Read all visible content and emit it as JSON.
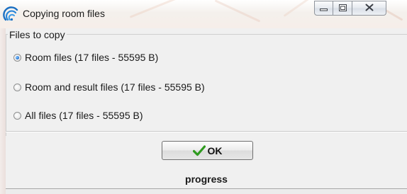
{
  "window": {
    "title": "Copying room files",
    "icon": "app-logo-icon",
    "controls": {
      "minimize_icon": "minimize-icon",
      "maximize_icon": "maximize-icon",
      "close_icon": "close-icon"
    }
  },
  "files_group": {
    "legend": "Files to copy",
    "options": [
      {
        "label": "Room files  (17 files - 55595  B)",
        "checked": true
      },
      {
        "label": "Room and result files  (17 files - 55595  B)",
        "checked": false
      },
      {
        "label": "All files  (17 files - 55595  B)",
        "checked": false
      }
    ]
  },
  "ok_button": {
    "label": "OK",
    "icon": "checkmark-icon"
  },
  "progress": {
    "label": "progress"
  },
  "colors": {
    "accent_blue": "#1e6fd1",
    "check_green": "#2e9a1e"
  }
}
